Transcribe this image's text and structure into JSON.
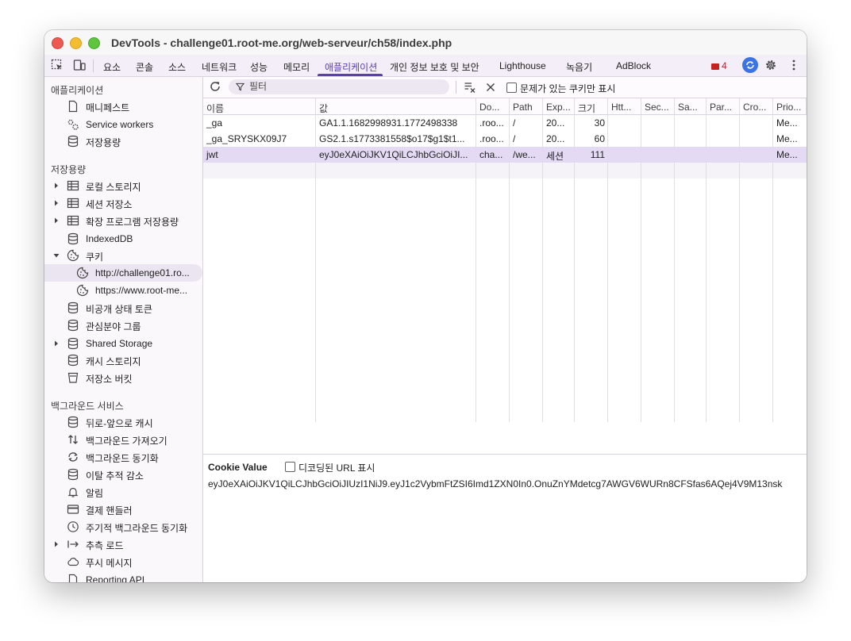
{
  "window": {
    "title": "DevTools - challenge01.root-me.org/web-serveur/ch58/index.php"
  },
  "tabs": [
    {
      "label": "요소"
    },
    {
      "label": "콘솔"
    },
    {
      "label": "소스"
    },
    {
      "label": "네트워크"
    },
    {
      "label": "성능"
    },
    {
      "label": "메모리"
    },
    {
      "label": "애플리케이션"
    },
    {
      "label": "개인 정보 보호 및 보안"
    },
    {
      "label": "Lighthouse"
    },
    {
      "label": "녹음기"
    },
    {
      "label": "AdBlock"
    }
  ],
  "issues_count": "4",
  "sidebar": {
    "section_app": "애플리케이션",
    "app_items": [
      {
        "label": "매니페스트"
      },
      {
        "label": "Service workers"
      },
      {
        "label": "저장용량"
      }
    ],
    "section_storage": "저장용량",
    "storage_items": [
      {
        "label": "로컬 스토리지"
      },
      {
        "label": "세션 저장소"
      },
      {
        "label": "확장 프로그램 저장용량"
      },
      {
        "label": "IndexedDB"
      },
      {
        "label": "쿠키"
      },
      {
        "label": "http://challenge01.ro..."
      },
      {
        "label": "https://www.root-me..."
      },
      {
        "label": "비공개 상태 토큰"
      },
      {
        "label": "관심분야 그룹"
      },
      {
        "label": "Shared Storage"
      },
      {
        "label": "캐시 스토리지"
      },
      {
        "label": "저장소 버킷"
      }
    ],
    "section_bg": "백그라운드 서비스",
    "bg_items": [
      {
        "label": "뒤로-앞으로 캐시"
      },
      {
        "label": "백그라운드 가져오기"
      },
      {
        "label": "백그라운드 동기화"
      },
      {
        "label": "이탈 추적 감소"
      },
      {
        "label": "알림"
      },
      {
        "label": "결제 핸들러"
      },
      {
        "label": "주기적 백그라운드 동기화"
      },
      {
        "label": "추측 로드"
      },
      {
        "label": "푸시 메시지"
      },
      {
        "label": "Reporting API"
      }
    ]
  },
  "toolbar": {
    "filter_placeholder": "필터",
    "only_issues_label": "문제가 있는 쿠키만 표시"
  },
  "table": {
    "columns": [
      "이름",
      "값",
      "Do...",
      "Path",
      "Exp...",
      "크기",
      "Htt...",
      "Sec...",
      "Sa...",
      "Par...",
      "Cro...",
      "Prio..."
    ],
    "rows": [
      [
        "_ga",
        "GA1.1.1682998931.1772498338",
        ".roo...",
        "/",
        "20...",
        "30",
        "",
        "",
        "",
        "",
        "",
        "Me..."
      ],
      [
        "_ga_SRYSKX09J7",
        "GS2.1.s1773381558$o17$g1$t1...",
        ".roo...",
        "/",
        "20...",
        "60",
        "",
        "",
        "",
        "",
        "",
        "Me..."
      ],
      [
        "jwt",
        "eyJ0eXAiOiJKV1QiLCJhbGciOiJI...",
        "cha...",
        "/we...",
        "세션",
        "111",
        "",
        "",
        "",
        "",
        "",
        "Me..."
      ]
    ]
  },
  "detail": {
    "title": "Cookie Value",
    "decode_label": "디코딩된 URL 표시",
    "value": "eyJ0eXAiOiJKV1QiLCJhbGciOiJIUzI1NiJ9.eyJ1c2VybmFtZSI6Imd1ZXN0In0.OnuZnYMdetcg7AWGV6WURn8CFSfas6AQej4V9M13nsk"
  }
}
